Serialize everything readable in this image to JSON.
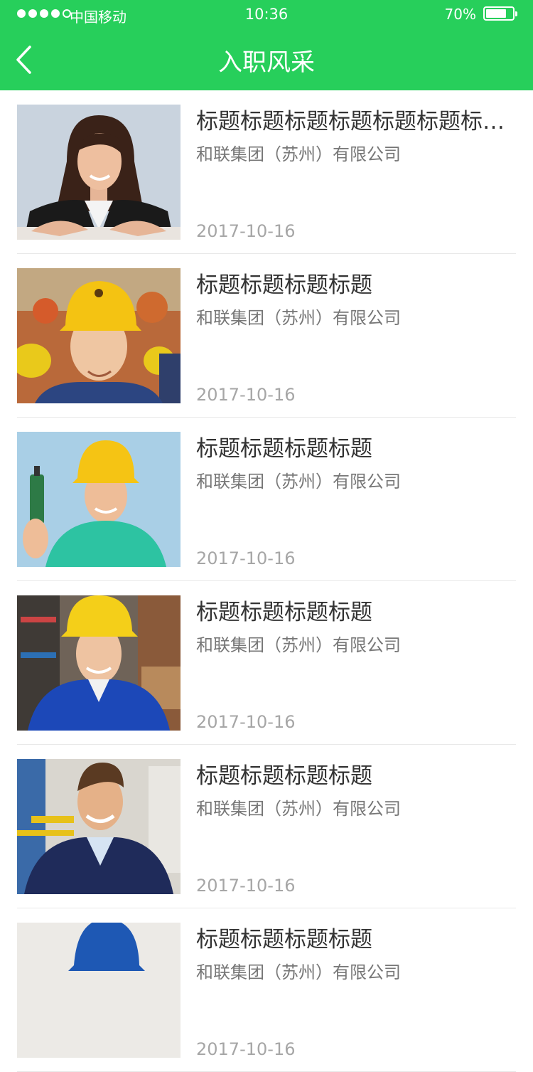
{
  "status_bar": {
    "carrier": "中国移动",
    "time": "10:36",
    "battery": "70%"
  },
  "navbar": {
    "title": "入职风采",
    "back_icon": "chevron-left-icon"
  },
  "colors": {
    "accent": "#27cf5b"
  },
  "items": [
    {
      "title": "标题标题标题标题标题标题标题标题标题",
      "company": "和联集团（苏州）有限公司",
      "date": "2017-10-16",
      "photo": "businesswoman-photo"
    },
    {
      "title": "标题标题标题标题",
      "company": "和联集团（苏州）有限公司",
      "date": "2017-10-16",
      "photo": "worker-woman-hardhat-photo"
    },
    {
      "title": "标题标题标题标题",
      "company": "和联集团（苏州）有限公司",
      "date": "2017-10-16",
      "photo": "worker-man-drill-photo"
    },
    {
      "title": "标题标题标题标题",
      "company": "和联集团（苏州）有限公司",
      "date": "2017-10-16",
      "photo": "worker-woman-warehouse-photo"
    },
    {
      "title": "标题标题标题标题",
      "company": "和联集团（苏州）有限公司",
      "date": "2017-10-16",
      "photo": "worker-man-factory-photo"
    },
    {
      "title": "标题标题标题标题",
      "company": "和联集团（苏州）有限公司",
      "date": "2017-10-16",
      "photo": "worker-blue-hardhat-photo"
    }
  ]
}
